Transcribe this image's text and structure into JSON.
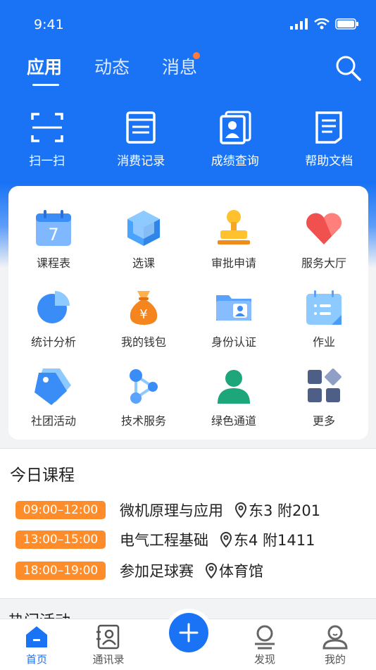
{
  "status": {
    "time": "9:41"
  },
  "tabs": [
    {
      "label": "应用",
      "active": true
    },
    {
      "label": "动态",
      "active": false
    },
    {
      "label": "消息",
      "active": false,
      "badge": true
    }
  ],
  "quick": [
    {
      "label": "扫一扫",
      "icon": "scan-icon"
    },
    {
      "label": "消费记录",
      "icon": "receipt-icon"
    },
    {
      "label": "成绩查询",
      "icon": "grade-icon"
    },
    {
      "label": "帮助文档",
      "icon": "document-icon"
    }
  ],
  "apps": [
    {
      "label": "课程表",
      "icon": "calendar-icon",
      "calendar_day": "7"
    },
    {
      "label": "选课",
      "icon": "cube-icon"
    },
    {
      "label": "审批申请",
      "icon": "stamp-icon"
    },
    {
      "label": "服务大厅",
      "icon": "heart-icon"
    },
    {
      "label": "统计分析",
      "icon": "pie-chart-icon"
    },
    {
      "label": "我的钱包",
      "icon": "money-bag-icon",
      "symbol": "¥"
    },
    {
      "label": "身份认证",
      "icon": "id-folder-icon"
    },
    {
      "label": "作业",
      "icon": "homework-icon"
    },
    {
      "label": "社团活动",
      "icon": "tag-icon"
    },
    {
      "label": "技术服务",
      "icon": "share-nodes-icon"
    },
    {
      "label": "绿色通道",
      "icon": "person-icon"
    },
    {
      "label": "更多",
      "icon": "more-grid-icon"
    }
  ],
  "today": {
    "title": "今日课程",
    "courses": [
      {
        "time": "09:00–12:00",
        "name": "微机原理与应用",
        "location": "东3 附201"
      },
      {
        "time": "13:00–15:00",
        "name": "电气工程基础",
        "location": "东4 附1411"
      },
      {
        "time": "18:00–19:00",
        "name": "参加足球赛",
        "location": "体育馆"
      }
    ]
  },
  "hot_title": "热门活动",
  "tabbar": [
    {
      "label": "首页",
      "active": true
    },
    {
      "label": "通讯录",
      "active": false
    },
    {
      "label": "发现",
      "active": false
    },
    {
      "label": "我的",
      "active": false
    }
  ],
  "colors": {
    "primary": "#1a73f5",
    "accent": "#ff8c2b"
  }
}
